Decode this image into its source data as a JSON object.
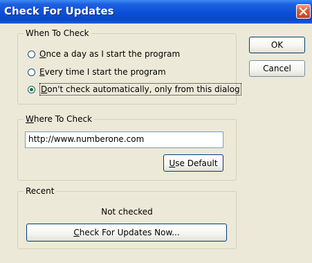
{
  "window": {
    "title": "Check For Updates",
    "close_icon": "close-icon"
  },
  "when_to_check": {
    "legend": "When To Check",
    "options": [
      {
        "mnemonic": "O",
        "rest": "nce a day as I start the program",
        "checked": false
      },
      {
        "mnemonic": "E",
        "rest": "very time I start the program",
        "checked": false
      },
      {
        "mnemonic": "D",
        "rest": "on't check automatically, only from this dialog",
        "checked": true
      }
    ]
  },
  "where_to_check": {
    "legend_mnemonic": "W",
    "legend_rest": "here To Check",
    "url_value": "http://www.numberone.com",
    "use_default": {
      "mnemonic": "U",
      "rest": "se Default"
    }
  },
  "recent": {
    "legend": "Recent",
    "status": "Not checked",
    "check_now": {
      "mnemonic": "C",
      "rest": "heck For Updates Now..."
    }
  },
  "buttons": {
    "ok": "OK",
    "cancel": "Cancel"
  },
  "colors": {
    "title_bar": "#0b4fd8",
    "dialog_bg": "#ece9d8",
    "close_button": "#e05a2e"
  }
}
